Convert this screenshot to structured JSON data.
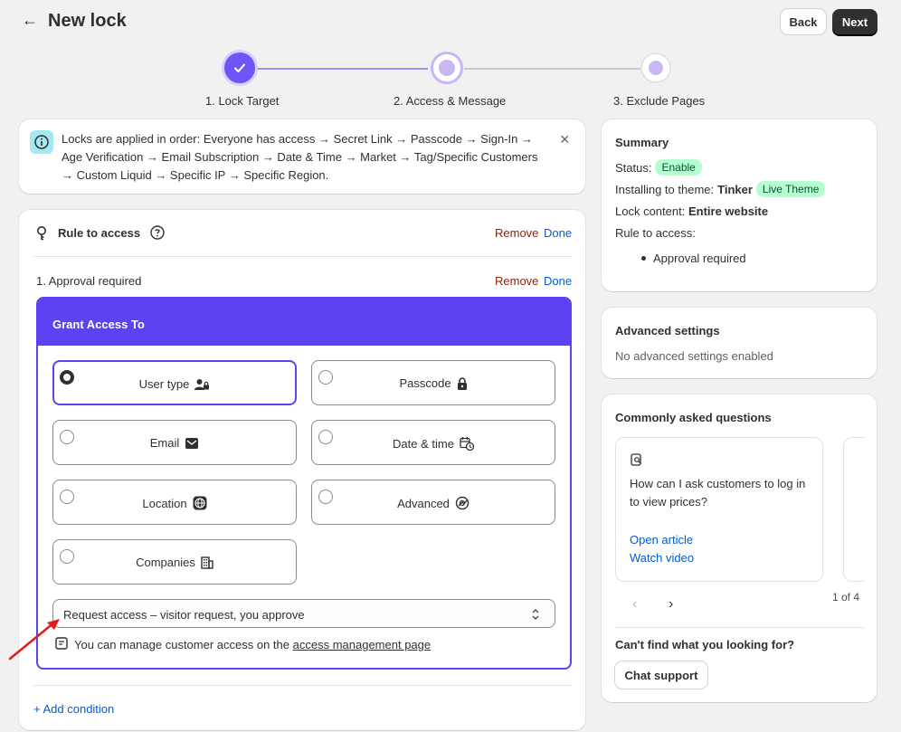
{
  "header": {
    "back_arrow": "←",
    "title": "New lock",
    "back_label": "Back",
    "next_label": "Next"
  },
  "steps": [
    {
      "label": "1. Lock Target"
    },
    {
      "label": "2. Access & Message"
    },
    {
      "label": "3. Exclude Pages"
    }
  ],
  "banner": {
    "text": "Locks are applied in order: Everyone has access → Secret Link → Passcode → Sign-In → Age Verification → Email Subscription → Date & Time → Market → Tag/Specific Customers → Custom Liquid → Specific IP → Specific Region.",
    "close": "×"
  },
  "rule": {
    "title": "Rule to access",
    "remove": "Remove",
    "done": "Done",
    "condition_label": "1. Approval required",
    "grant_title": "Grant Access To",
    "options": [
      {
        "label": "User type",
        "icon": "user-lock-icon"
      },
      {
        "label": "Passcode",
        "icon": "lock-icon"
      },
      {
        "label": "Email",
        "icon": "email-icon"
      },
      {
        "label": "Date & time",
        "icon": "calendar-clock-icon"
      },
      {
        "label": "Location",
        "icon": "globe-icon"
      },
      {
        "label": "Advanced",
        "icon": "advanced-icon"
      },
      {
        "label": "Companies",
        "icon": "building-icon"
      }
    ],
    "select_value": "Request access – visitor request, you approve",
    "note_prefix": "You can manage customer access on the ",
    "note_link": "access management page",
    "add_condition": "+ Add condition"
  },
  "summary": {
    "title": "Summary",
    "status_label": "Status:",
    "status_value": "Enable",
    "theme_label": "Installing to theme:",
    "theme_name": "Tinker",
    "theme_badge": "Live Theme",
    "content_label": "Lock content:",
    "content_value": "Entire website",
    "rule_label": "Rule to access:",
    "rule_item": "Approval required"
  },
  "advanced": {
    "title": "Advanced settings",
    "text": "No advanced settings enabled"
  },
  "faq": {
    "title": "Commonly asked questions",
    "question": "How can I ask customers to log in to view prices?",
    "open_article": "Open article",
    "watch_video": "Watch video",
    "pager": "1 of 4",
    "help_title": "Can't find what you looking for?",
    "chat": "Chat support"
  },
  "colors": {
    "accent": "#5b42f3",
    "step_done": "#6e55f5",
    "step_line": "#a78bfa"
  }
}
